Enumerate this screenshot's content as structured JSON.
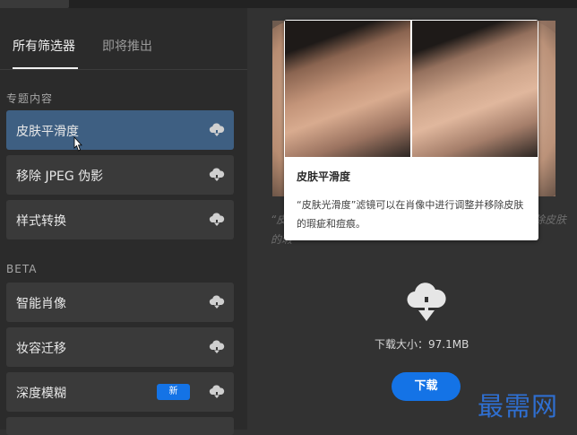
{
  "tabs": {
    "all": "所有筛选器",
    "upcoming": "即将推出"
  },
  "sections": {
    "featured": {
      "label": "专题内容",
      "items": [
        {
          "label": "皮肤平滑度",
          "selected": true
        },
        {
          "label": "移除 JPEG 伪影"
        },
        {
          "label": "样式转换"
        }
      ]
    },
    "beta": {
      "label": "BETA",
      "items": [
        {
          "label": "智能肖像"
        },
        {
          "label": "妆容迁移"
        },
        {
          "label": "深度模糊",
          "badge": "新"
        }
      ]
    }
  },
  "tooltip": {
    "title": "皮肤平滑度",
    "description": "“皮肤光滑度”滤镜可以在肖像中进行调整并移除皮肤的瑕疵和痘痕。"
  },
  "background_text": {
    "line1_left": "“皮",
    "line1_right": "除皮肤",
    "line2_left": "的瑕"
  },
  "download": {
    "size_label": "下载大小：97.1MB",
    "button": "下载"
  },
  "watermark": "最需网",
  "icons": {
    "cloud": "cloud-download-icon",
    "cursor": "mouse-pointer-icon"
  },
  "colors": {
    "accent": "#1473e6",
    "selected": "#3e5f82",
    "watermark": "#2f6fd1"
  }
}
